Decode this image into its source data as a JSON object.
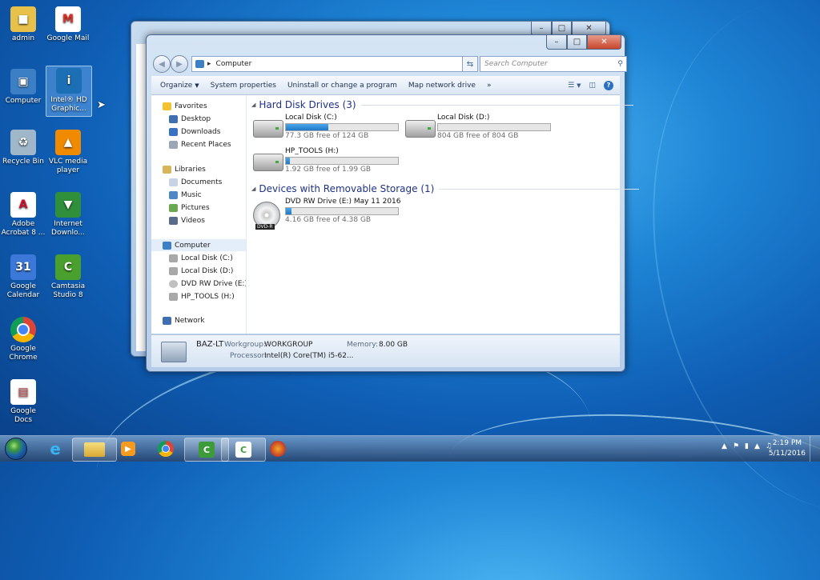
{
  "desktop": {
    "icons": [
      {
        "label": "admin",
        "icon": "user-folder-icon",
        "color": "#e8c14a"
      },
      {
        "label": "Google Mail",
        "icon": "gmail-icon",
        "color": "#d93025"
      },
      {
        "label": "Computer",
        "icon": "computer-icon",
        "color": "#3d7fc4"
      },
      {
        "label": "Intel® HD Graphic...",
        "icon": "intel-graphics-icon",
        "color": "#1c6fb5"
      },
      {
        "label": "Recycle Bin",
        "icon": "recycle-bin-icon",
        "color": "#9fb7c8"
      },
      {
        "label": "VLC media player",
        "icon": "vlc-icon",
        "color": "#f08a00"
      },
      {
        "label": "Adobe Acrobat 8 ...",
        "icon": "adobe-acrobat-icon",
        "color": "#c8102e"
      },
      {
        "label": "Internet Downlo...",
        "icon": "internet-download-manager-icon",
        "color": "#2f8f3a"
      },
      {
        "label": "Google Calendar",
        "icon": "google-calendar-icon",
        "color": "#3b78d8"
      },
      {
        "label": "Camtasia Studio 8",
        "icon": "camtasia-icon",
        "color": "#4aa02c"
      },
      {
        "label": "Google Chrome",
        "icon": "chrome-icon",
        "color": "#db4437"
      },
      {
        "label": "Google Docs",
        "icon": "google-docs-icon",
        "color": "#c94f4f"
      }
    ]
  },
  "explorer": {
    "address": "Computer",
    "search_placeholder": "Search Computer",
    "toolbar": {
      "organize": "Organize",
      "system_properties": "System properties",
      "uninstall": "Uninstall or change a program",
      "map_drive": "Map network drive",
      "more": "»"
    },
    "nav": {
      "favorites": "Favorites",
      "desktop": "Desktop",
      "downloads": "Downloads",
      "recent": "Recent Places",
      "libraries": "Libraries",
      "documents": "Documents",
      "music": "Music",
      "pictures": "Pictures",
      "videos": "Videos",
      "computer": "Computer",
      "disk_c": "Local Disk (C:)",
      "disk_d": "Local Disk (D:)",
      "dvd": "DVD RW Drive (E:) M",
      "hp_tools": "HP_TOOLS (H:)",
      "network": "Network"
    },
    "groups": {
      "hdd": "Hard Disk Drives (3)",
      "removable": "Devices with Removable Storage (1)"
    },
    "drives": [
      {
        "name": "Local Disk (C:)",
        "free": "77.3 GB free of 124 GB",
        "used_fraction": 0.38
      },
      {
        "name": "Local Disk (D:)",
        "free": "804 GB free of 804 GB",
        "used_fraction": 0.0
      },
      {
        "name": "HP_TOOLS (H:)",
        "free": "1.92 GB free of 1.99 GB",
        "used_fraction": 0.035
      },
      {
        "name": "DVD RW Drive (E:) May 11 2016",
        "free": "4.16 GB free of 4.38 GB",
        "used_fraction": 0.05,
        "badge": "DVD-R"
      }
    ],
    "details": {
      "name": "BAZ-LT",
      "workgroup_label": "Workgroup:",
      "workgroup": "WORKGROUP",
      "memory_label": "Memory:",
      "memory": "8.00 GB",
      "processor_label": "Processor:",
      "processor": "Intel(R) Core(TM) i5-62..."
    }
  },
  "taskbar": {
    "clock_time": "2:19 PM",
    "clock_date": "5/11/2016"
  }
}
